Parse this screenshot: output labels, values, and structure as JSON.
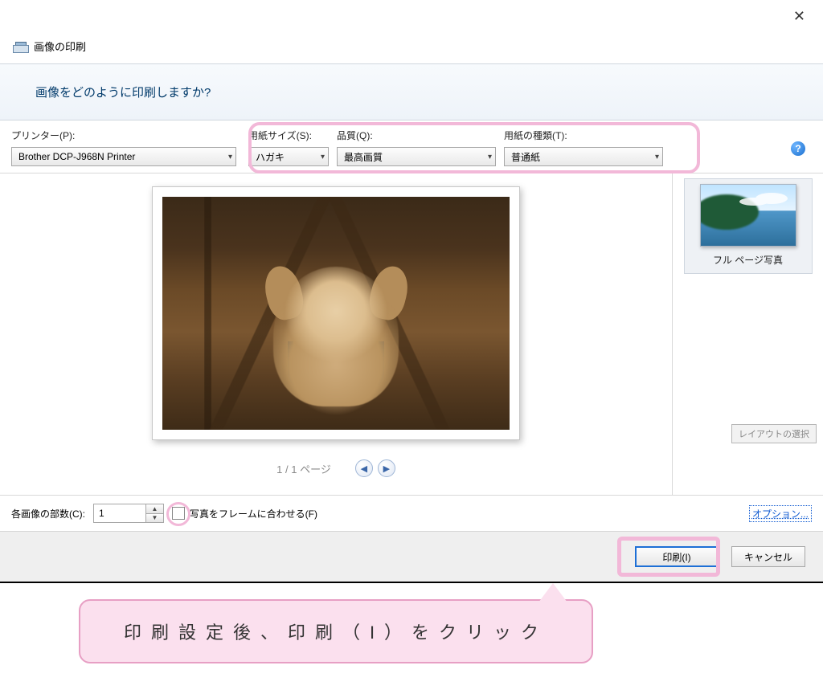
{
  "window": {
    "title": "画像の印刷",
    "instruction": "画像をどのように印刷しますか?"
  },
  "settings": {
    "printer": {
      "label": "プリンター(P):",
      "value": "Brother DCP-J968N Printer"
    },
    "paper_size": {
      "label": "用紙サイズ(S):",
      "value": "ハガキ"
    },
    "quality": {
      "label": "品質(Q):",
      "value": "最高画質"
    },
    "paper_type": {
      "label": "用紙の種類(T):",
      "value": "普通紙"
    }
  },
  "pager": {
    "text": "1 / 1 ページ"
  },
  "layout": {
    "option_label": "フル ページ写真",
    "select_label": "レイアウトの選択"
  },
  "bottom": {
    "copies_label": "各画像の部数(C):",
    "copies_value": "1",
    "fit_frame_label": "写真をフレームに合わせる(F)",
    "options_link": "オプション..."
  },
  "actions": {
    "print": "印刷(I)",
    "cancel": "キャンセル"
  },
  "annotation": {
    "caption": "印刷設定後、印刷（I）をクリック"
  }
}
